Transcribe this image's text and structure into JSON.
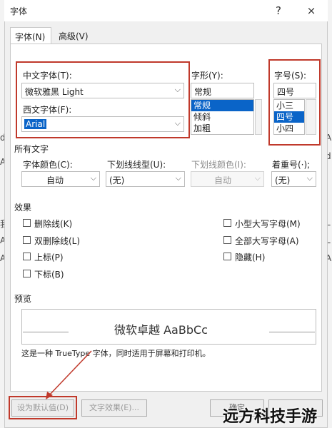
{
  "window": {
    "title": "字体",
    "help_icon": "?",
    "close_icon": "×"
  },
  "tabs": [
    {
      "label": "字体(N)",
      "active": true
    },
    {
      "label": "高级(V)",
      "active": false
    }
  ],
  "edge_left": [
    "d",
    "A",
    "我",
    "A",
    "A"
  ],
  "edge_right": [
    "A",
    "d",
    "L",
    "L",
    "A"
  ],
  "chinese_font": {
    "label": "中文字体(T):",
    "value": "微软雅黑 Light"
  },
  "western_font": {
    "label": "西文字体(F):",
    "value": "Arial"
  },
  "font_style": {
    "label": "字形(Y):",
    "value": "常规",
    "options": [
      "常规",
      "倾斜",
      "加粗"
    ],
    "selected_index": 0
  },
  "font_size": {
    "label": "字号(S):",
    "value": "四号",
    "options": [
      "小三",
      "四号",
      "小四"
    ],
    "selected_index": 1
  },
  "all_text": {
    "section_label": "所有文字",
    "font_color": {
      "label": "字体颜色(C):",
      "value": "自动"
    },
    "underline_style": {
      "label": "下划线线型(U):",
      "value": "(无)"
    },
    "underline_color": {
      "label": "下划线颜色(I):",
      "value": "自动"
    },
    "emphasis": {
      "label": "着重号(·);",
      "value": "(无)"
    }
  },
  "effects": {
    "section_label": "效果",
    "left": [
      "删除线(K)",
      "双删除线(L)",
      "上标(P)",
      "下标(B)"
    ],
    "right": [
      "小型大写字母(M)",
      "全部大写字母(A)",
      "隐藏(H)"
    ]
  },
  "preview": {
    "section_label": "预览",
    "sample": "微软卓越  AaBbCc",
    "note": "这是一种 TrueType 字体，同时适用于屏幕和打印机。"
  },
  "buttons": {
    "set_default": "设为默认值(D)",
    "text_effects": "文字效果(E)...",
    "ok": "确定"
  },
  "watermark": "远方科技手游",
  "colors": {
    "highlight": "#c0392b",
    "selection": "#0a64c8",
    "dialog_bg": "#f0f0f0"
  }
}
